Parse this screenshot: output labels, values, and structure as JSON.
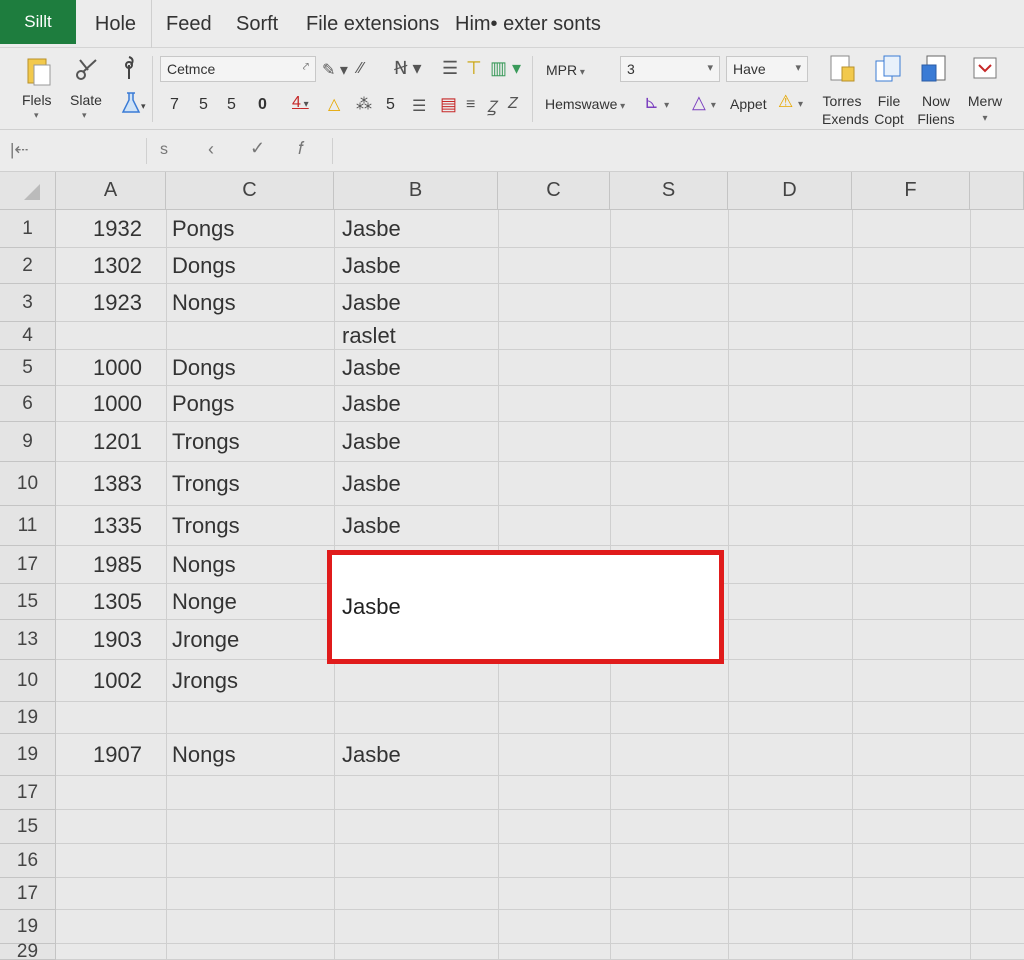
{
  "menubar": {
    "app_tab": "Sillt",
    "tabs": [
      "Hole",
      "Feed",
      "Sorft",
      "File extensions",
      "Him• exter sonts"
    ]
  },
  "ribbon": {
    "files_label": "Flels",
    "slate_label": "Slate",
    "font_box": "Cetmce",
    "number_row": [
      "7",
      "5",
      "5"
    ],
    "digit_4": "4",
    "digit_5": "5",
    "mpr_label": "MPR",
    "size_box": "3",
    "have_box": "Have",
    "hemswawe_label": "Hemswawe",
    "appet_label": "Appet",
    "big_buttons": [
      {
        "line1": "Torres",
        "line2": "Exends",
        "icon": "page-paint-icon"
      },
      {
        "line1": "File",
        "line2": "Copt",
        "icon": "file-copy-icon"
      },
      {
        "line1": "Now",
        "line2": "Fliens",
        "icon": "new-files-icon"
      },
      {
        "line1": "Merw",
        "line2": "",
        "icon": "merge-icon"
      }
    ]
  },
  "formulabar": {
    "name_box": "|⇠",
    "fx_items": [
      "s",
      "‹"
    ]
  },
  "grid": {
    "columns": [
      "A",
      "C",
      "B",
      "C",
      "S",
      "D",
      "F"
    ],
    "rows": [
      {
        "num": "1",
        "a": "1932",
        "c": "Pongs",
        "b": "Jasbe"
      },
      {
        "num": "2",
        "a": "1302",
        "c": "Dongs",
        "b": "Jasbe"
      },
      {
        "num": "3",
        "a": "1923",
        "c": "Nongs",
        "b": "Jasbe"
      },
      {
        "num": "4",
        "a": "",
        "c": "",
        "b": "raslet"
      },
      {
        "num": "5",
        "a": "1000",
        "c": "Dongs",
        "b": "Jasbe"
      },
      {
        "num": "6",
        "a": "1000",
        "c": "Pongs",
        "b": "Jasbe"
      },
      {
        "num": "9",
        "a": "1201",
        "c": "Trongs",
        "b": "Jasbe"
      },
      {
        "num": "10",
        "a": "1383",
        "c": "Trongs",
        "b": "Jasbe"
      },
      {
        "num": "11",
        "a": "1335",
        "c": "Trongs",
        "b": "Jasbe"
      },
      {
        "num": "17",
        "a": "1985",
        "c": "Nongs",
        "b": ""
      },
      {
        "num": "15",
        "a": "1305",
        "c": "Nonge",
        "b": ""
      },
      {
        "num": "13",
        "a": "1903",
        "c": "Jronge",
        "b": ""
      },
      {
        "num": "10",
        "a": "1002",
        "c": "Jrongs",
        "b": ""
      },
      {
        "num": "19",
        "a": "",
        "c": "",
        "b": ""
      },
      {
        "num": "19",
        "a": "1907",
        "c": "Nongs",
        "b": "Jasbe"
      },
      {
        "num": "17",
        "a": "",
        "c": "",
        "b": ""
      },
      {
        "num": "15",
        "a": "",
        "c": "",
        "b": ""
      },
      {
        "num": "16",
        "a": "",
        "c": "",
        "b": ""
      },
      {
        "num": "17",
        "a": "",
        "c": "",
        "b": ""
      },
      {
        "num": "19",
        "a": "",
        "c": "",
        "b": ""
      },
      {
        "num": "29",
        "a": "",
        "c": "",
        "b": ""
      }
    ],
    "selected_cell_value": "Jasbe",
    "selection_color": "#e01b1b",
    "app_accent": "#1e7d3e"
  }
}
